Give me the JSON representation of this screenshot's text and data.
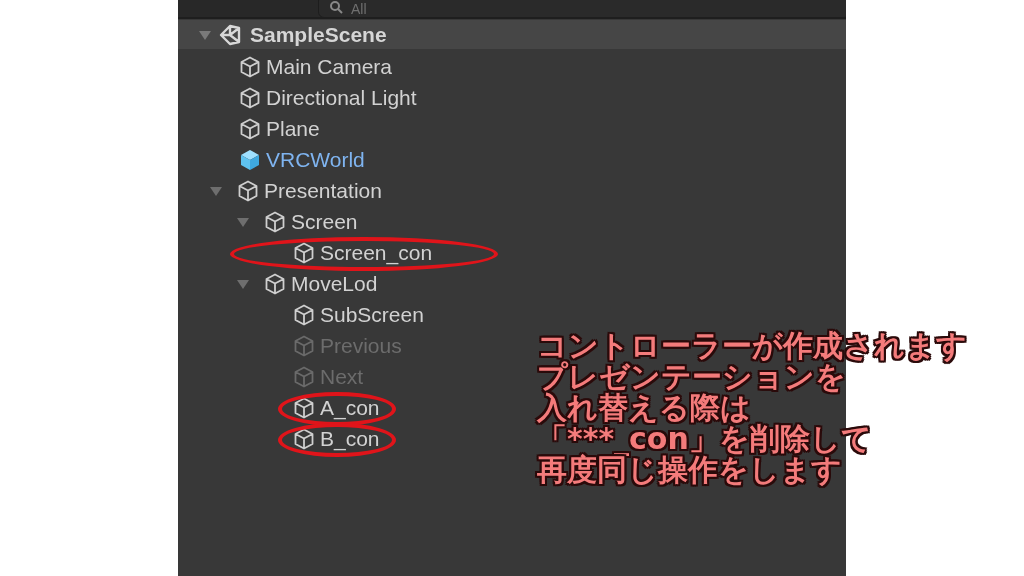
{
  "search": {
    "placeholder": "All"
  },
  "scene": {
    "name": "SampleScene",
    "expanded": true,
    "children": [
      {
        "name": "Main Camera",
        "kind": "object",
        "disabled": false,
        "circled": false
      },
      {
        "name": "Directional Light",
        "kind": "object",
        "disabled": false,
        "circled": false
      },
      {
        "name": "Plane",
        "kind": "object",
        "disabled": false,
        "circled": false
      },
      {
        "name": "VRCWorld",
        "kind": "prefab",
        "disabled": false,
        "circled": false
      },
      {
        "name": "Presentation",
        "kind": "object",
        "disabled": false,
        "circled": false,
        "expanded": true,
        "children": [
          {
            "name": "Screen",
            "kind": "object",
            "disabled": false,
            "circled": false,
            "expanded": true,
            "children": [
              {
                "name": "Screen_con",
                "kind": "object",
                "disabled": false,
                "circled": true
              }
            ]
          },
          {
            "name": "MoveLod",
            "kind": "object",
            "disabled": false,
            "circled": false,
            "expanded": true,
            "children": [
              {
                "name": "SubScreen",
                "kind": "object",
                "disabled": false,
                "circled": false
              },
              {
                "name": "Previous",
                "kind": "object",
                "disabled": true,
                "circled": false
              },
              {
                "name": "Next",
                "kind": "object",
                "disabled": true,
                "circled": false
              },
              {
                "name": "A_con",
                "kind": "object",
                "disabled": false,
                "circled": true
              },
              {
                "name": "B_con",
                "kind": "object",
                "disabled": false,
                "circled": true
              }
            ]
          }
        ]
      }
    ]
  },
  "annotation": {
    "lines": [
      "コントローラーが作成されます",
      "プレゼンテーションを",
      "入れ替える際は",
      "「***_con」を削除して",
      "再度同じ操作をします"
    ]
  }
}
